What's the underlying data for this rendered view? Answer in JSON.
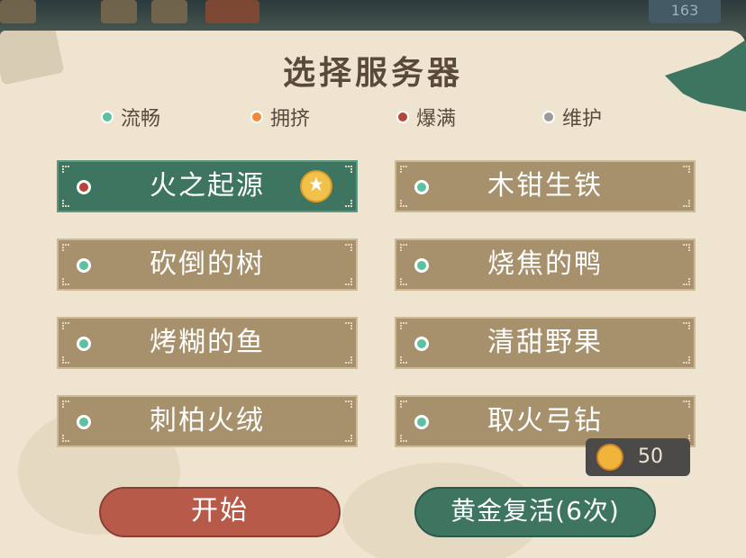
{
  "top_bar": {
    "counter": "163"
  },
  "title": "选择服务器",
  "legend": [
    {
      "label": "流畅",
      "color": "#5bc2a0"
    },
    {
      "label": "拥挤",
      "color": "#f08a3a"
    },
    {
      "label": "爆满",
      "color": "#b5453a"
    },
    {
      "label": "维护",
      "color": "#9a9a9a"
    }
  ],
  "servers": [
    {
      "name": "火之起源",
      "status_color": "#b5453a",
      "selected": true,
      "badge": "star-badge-icon"
    },
    {
      "name": "木钳生铁",
      "status_color": "#5bc2a0",
      "selected": false
    },
    {
      "name": "砍倒的树",
      "status_color": "#5bc2a0",
      "selected": false
    },
    {
      "name": "烧焦的鸭",
      "status_color": "#5bc2a0",
      "selected": false
    },
    {
      "name": "烤糊的鱼",
      "status_color": "#5bc2a0",
      "selected": false
    },
    {
      "name": "清甜野果",
      "status_color": "#5bc2a0",
      "selected": false
    },
    {
      "name": "刺柏火绒",
      "status_color": "#5bc2a0",
      "selected": false
    },
    {
      "name": "取火弓钻",
      "status_color": "#5bc2a0",
      "selected": false
    }
  ],
  "buttons": {
    "start": "开始",
    "revive": "黄金复活(6次)"
  },
  "cost": {
    "value": "50",
    "icon": "gold-coin-icon"
  },
  "colors": {
    "parchment": "#efe4cf",
    "server_normal": "#a7916d",
    "server_selected": "#3d7561",
    "start_red": "#b85a4a",
    "revive_green": "#3d7561"
  }
}
